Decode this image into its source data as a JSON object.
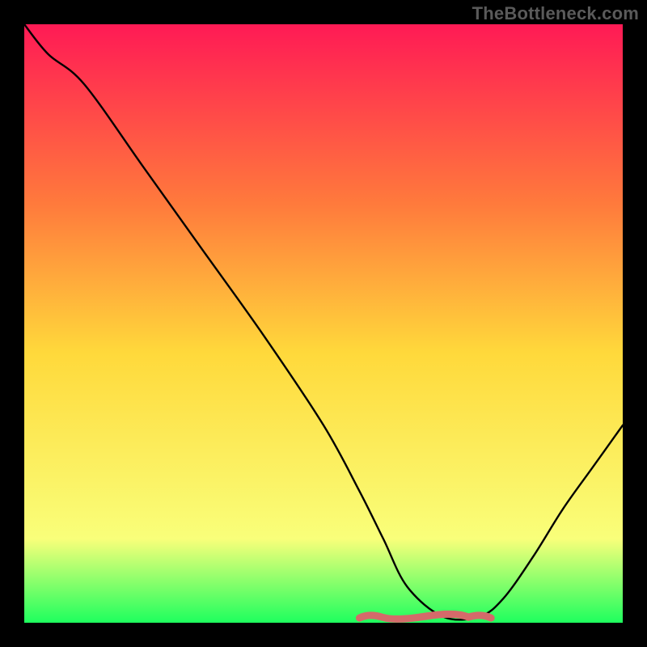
{
  "attribution": "TheBottleneck.com",
  "colors": {
    "frame": "#000000",
    "curve": "#000000",
    "flat_marker": "#d46a6a",
    "gradient_top": "#ff1a55",
    "gradient_mid_upper": "#ff7a3c",
    "gradient_mid": "#ffd93b",
    "gradient_lower": "#f9ff7a",
    "gradient_bottom": "#1eff5e"
  },
  "chart_data": {
    "type": "line",
    "title": "",
    "xlabel": "",
    "ylabel": "",
    "xlim": [
      0,
      100
    ],
    "ylim": [
      0,
      100
    ],
    "x": [
      0,
      4,
      10,
      20,
      30,
      40,
      50,
      56,
      60,
      64,
      70,
      76,
      80,
      85,
      90,
      95,
      100
    ],
    "values": [
      100,
      95,
      90,
      76,
      62,
      48,
      33,
      22,
      14,
      6,
      1,
      1,
      4,
      11,
      19,
      26,
      33
    ],
    "flat_region": {
      "x_start": 56,
      "x_end": 78,
      "y": 1.2
    }
  }
}
